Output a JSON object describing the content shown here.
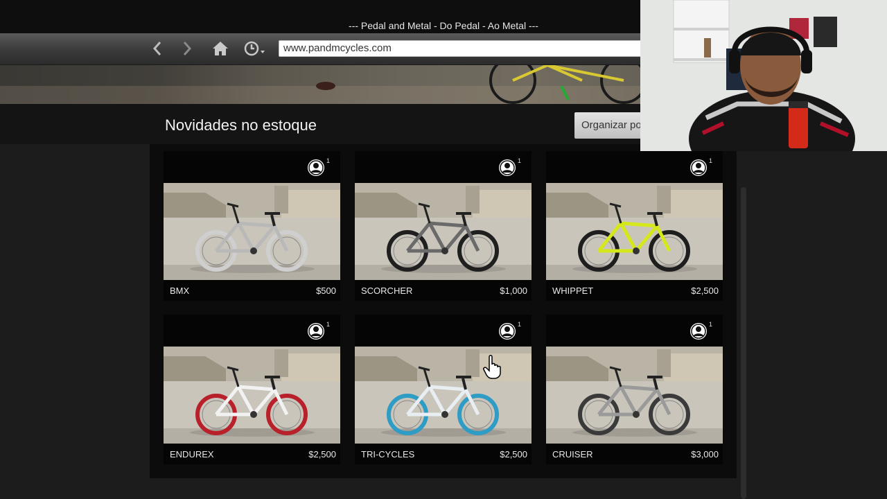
{
  "window": {
    "title": "--- Pedal and Metal - Do Pedal - Ao Metal ---"
  },
  "browser": {
    "url": "www.pandmcycles.com",
    "icons": [
      "back-arrow-icon",
      "forward-arrow-icon",
      "home-icon",
      "history-clock-icon"
    ]
  },
  "section": {
    "title": "Novidades no estoque",
    "sort_label": "Organizar po"
  },
  "products": [
    {
      "name": "BMX",
      "price": "$500",
      "players": "1",
      "wheel_color": "#cfcfcf",
      "frame_color": "#b9b9b9"
    },
    {
      "name": "SCORCHER",
      "price": "$1,000",
      "players": "1",
      "wheel_color": "#1f1f1f",
      "frame_color": "#6a6a6a"
    },
    {
      "name": "WHIPPET",
      "price": "$2,500",
      "players": "1",
      "wheel_color": "#1e1e1e",
      "frame_color": "#d4e81c"
    },
    {
      "name": "ENDUREX",
      "price": "$2,500",
      "players": "1",
      "wheel_color": "#b8202a",
      "frame_color": "#f2f2f2"
    },
    {
      "name": "TRI-CYCLES",
      "price": "$2,500",
      "players": "1",
      "wheel_color": "#2e9cc4",
      "frame_color": "#e8eef2"
    },
    {
      "name": "CRUISER",
      "price": "$3,000",
      "players": "1",
      "wheel_color": "#3a3a3a",
      "frame_color": "#9a9a9a"
    }
  ]
}
